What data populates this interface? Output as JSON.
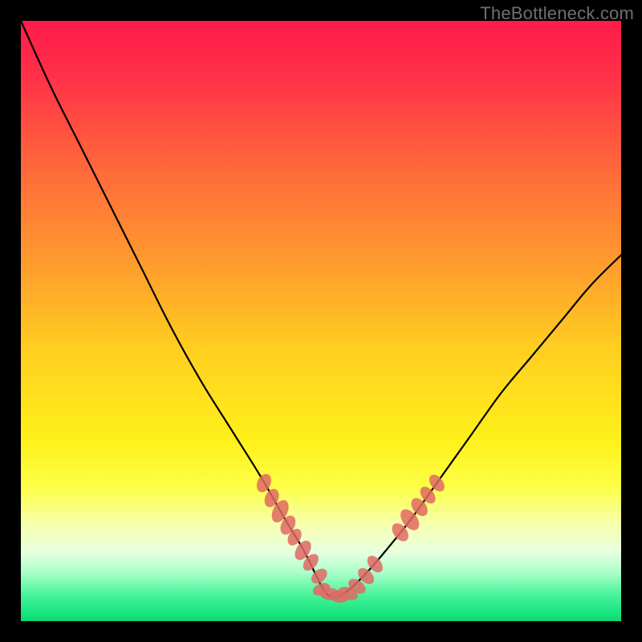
{
  "watermark": "TheBottleneck.com",
  "gradient": {
    "stops": [
      {
        "offset": 0.0,
        "color": "#ff1a4b"
      },
      {
        "offset": 0.1,
        "color": "#ff3347"
      },
      {
        "offset": 0.25,
        "color": "#ff6a3a"
      },
      {
        "offset": 0.4,
        "color": "#ff9a2e"
      },
      {
        "offset": 0.55,
        "color": "#ffcf20"
      },
      {
        "offset": 0.7,
        "color": "#fff11a"
      },
      {
        "offset": 0.78,
        "color": "#fcff4a"
      },
      {
        "offset": 0.84,
        "color": "#f6ffb0"
      },
      {
        "offset": 0.885,
        "color": "#e8ffe0"
      },
      {
        "offset": 0.92,
        "color": "#a8ffc8"
      },
      {
        "offset": 0.955,
        "color": "#4cf39d"
      },
      {
        "offset": 0.985,
        "color": "#19e67f"
      },
      {
        "offset": 1.0,
        "color": "#0fd873"
      }
    ]
  },
  "chart_data": {
    "type": "line",
    "title": "",
    "xlabel": "",
    "ylabel": "",
    "xlim": [
      0,
      100
    ],
    "ylim": [
      0,
      100
    ],
    "series": [
      {
        "name": "curve",
        "x": [
          0,
          5,
          10,
          15,
          20,
          25,
          30,
          35,
          40,
          44,
          47,
          49,
          50,
          51,
          52,
          53,
          55,
          58,
          61,
          65,
          70,
          75,
          80,
          85,
          90,
          95,
          100
        ],
        "y": [
          100,
          89,
          79,
          69,
          59,
          49,
          40,
          32,
          24,
          17,
          12,
          8,
          6,
          4.5,
          4,
          4.2,
          5.5,
          8.5,
          12,
          17,
          24,
          31,
          38,
          44,
          50,
          56,
          61
        ]
      }
    ],
    "markers": [
      {
        "x": 40.5,
        "y": 23,
        "rx": 1.6,
        "ry": 1.1,
        "angle": -65
      },
      {
        "x": 41.8,
        "y": 20.5,
        "rx": 1.6,
        "ry": 1.1,
        "angle": -65
      },
      {
        "x": 43.2,
        "y": 18.3,
        "rx": 2.0,
        "ry": 1.2,
        "angle": -63
      },
      {
        "x": 44.5,
        "y": 16.0,
        "rx": 1.7,
        "ry": 1.1,
        "angle": -62
      },
      {
        "x": 45.6,
        "y": 14.0,
        "rx": 1.5,
        "ry": 1.0,
        "angle": -60
      },
      {
        "x": 47.0,
        "y": 11.8,
        "rx": 1.8,
        "ry": 1.1,
        "angle": -57
      },
      {
        "x": 48.3,
        "y": 9.8,
        "rx": 1.6,
        "ry": 1.0,
        "angle": -50
      },
      {
        "x": 49.7,
        "y": 7.5,
        "rx": 1.5,
        "ry": 1.0,
        "angle": -40
      },
      {
        "x": 50.1,
        "y": 5.3,
        "rx": 1.5,
        "ry": 1.0,
        "angle": -20
      },
      {
        "x": 51.5,
        "y": 4.5,
        "rx": 1.6,
        "ry": 1.0,
        "angle": 0
      },
      {
        "x": 53.0,
        "y": 4.1,
        "rx": 1.6,
        "ry": 1.0,
        "angle": 10
      },
      {
        "x": 54.5,
        "y": 4.6,
        "rx": 1.7,
        "ry": 1.0,
        "angle": 20
      },
      {
        "x": 56.0,
        "y": 5.8,
        "rx": 1.6,
        "ry": 1.0,
        "angle": 35
      },
      {
        "x": 57.5,
        "y": 7.5,
        "rx": 1.6,
        "ry": 1.0,
        "angle": 45
      },
      {
        "x": 59.0,
        "y": 9.5,
        "rx": 1.6,
        "ry": 1.0,
        "angle": 50
      },
      {
        "x": 63.2,
        "y": 14.8,
        "rx": 1.7,
        "ry": 1.1,
        "angle": 52
      },
      {
        "x": 64.8,
        "y": 16.9,
        "rx": 2.0,
        "ry": 1.2,
        "angle": 52
      },
      {
        "x": 66.4,
        "y": 19.0,
        "rx": 1.7,
        "ry": 1.1,
        "angle": 52
      },
      {
        "x": 67.8,
        "y": 21.0,
        "rx": 1.6,
        "ry": 1.0,
        "angle": 52
      },
      {
        "x": 69.3,
        "y": 23.0,
        "rx": 1.6,
        "ry": 1.0,
        "angle": 52
      }
    ],
    "marker_color": "#e06864",
    "curve_color": "#000000",
    "curve_width": 2.2
  }
}
